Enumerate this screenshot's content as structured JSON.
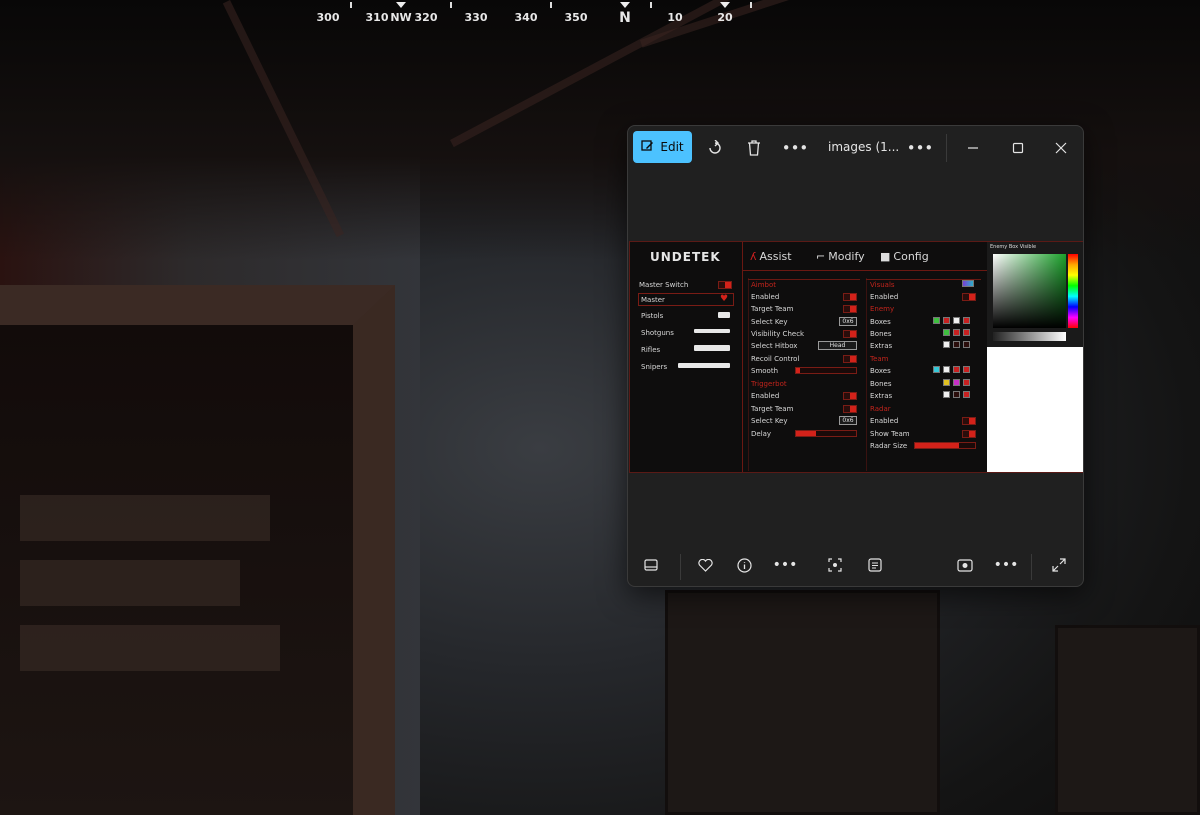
{
  "compass": {
    "labels": [
      "300",
      "310",
      "NW",
      "320",
      "330",
      "340",
      "350",
      "N",
      "10",
      "20"
    ]
  },
  "viewer": {
    "toolbar": {
      "edit_label": "Edit",
      "rotate_icon": "rotate-icon",
      "delete_icon": "trash-icon",
      "filename": "images (1..."
    },
    "window_controls": [
      "minimize-icon",
      "maximize-icon",
      "close-icon"
    ],
    "bottom_icons": [
      "filmstrip-icon",
      "heart-icon",
      "info-icon",
      "more-icon",
      "scan-icon",
      "text-scan-icon",
      "screen-capture-icon",
      "more-icon",
      "expand-icon"
    ]
  },
  "image": {
    "logo": "UNDETEK",
    "tabs": [
      "Assist",
      "Modify",
      "Config"
    ],
    "left_menu": {
      "master_switch": "Master Switch",
      "items": [
        "Master",
        "Pistols",
        "Shotguns",
        "Rifles",
        "Snipers"
      ]
    },
    "aimbot": {
      "heading": "Aimbot",
      "rows": [
        "Enabled",
        "Target Team",
        "Select Key",
        "Visibility Check",
        "Select Hitbox",
        "Recoil Control",
        "Smooth"
      ],
      "select_key": "0x6",
      "hitbox": "Head"
    },
    "triggerbot": {
      "heading": "Triggerbot",
      "rows": [
        "Enabled",
        "Target Team",
        "Select Key",
        "Delay"
      ],
      "select_key": "0x6"
    },
    "visuals": {
      "heading": "Visuals",
      "enabled": "Enabled",
      "enemy_heading": "Enemy",
      "enemy_rows": [
        "Boxes",
        "Bones",
        "Extras"
      ],
      "team_heading": "Team",
      "team_rows": [
        "Boxes",
        "Bones",
        "Extras"
      ]
    },
    "radar": {
      "heading": "Radar",
      "rows": [
        "Enabled",
        "Show Team",
        "Radar Size"
      ]
    },
    "color_picker": {
      "title": "Enemy Box Visible"
    },
    "colors": {
      "accent": "#d3221a",
      "border": "#6a1812"
    }
  }
}
